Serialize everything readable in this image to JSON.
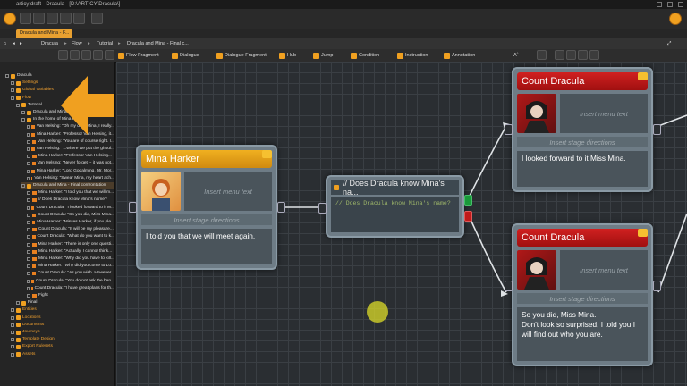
{
  "window": {
    "title": "articy:draft - Dracula - [D:\\ARTICY\\Dracula\\]"
  },
  "tab": {
    "label": "Dracula and Mina - F..."
  },
  "breadcrumb": [
    "Dracula",
    "Flow",
    "Tutorial",
    "Dracula and Mina - Final c..."
  ],
  "toolbar": {
    "items": [
      "Flow Fragment",
      "Dialogue",
      "Dialogue Fragment",
      "Hub",
      "Jump",
      "Condition",
      "Instruction",
      "Annotation"
    ],
    "font_size": "Aˆ"
  },
  "sidebar": {
    "tree": [
      {
        "label": "Dracula",
        "indent": 0,
        "orange": false
      },
      {
        "label": "Settings",
        "indent": 1,
        "orange": true
      },
      {
        "label": "Global Variables",
        "indent": 1,
        "orange": true
      },
      {
        "label": "Flow",
        "indent": 1,
        "orange": true
      },
      {
        "label": "Tutorial",
        "indent": 2,
        "orange": false
      },
      {
        "label": "Dracula and Mina - First meeting",
        "indent": 3,
        "orange": false
      },
      {
        "label": "In the home of Mina Harker",
        "indent": 3,
        "orange": false
      },
      {
        "label": "Van Helsing: \"Oh my dear Mina, I really...",
        "indent": 4,
        "orange": false
      },
      {
        "label": "Mina Harker: \"Professor Van Helsing, it...",
        "indent": 4,
        "orange": false
      },
      {
        "label": "Van Helsing: \"You are of course right. I...",
        "indent": 4,
        "orange": false
      },
      {
        "label": "Van Helsing: \"...where we put the ghoul...",
        "indent": 4,
        "orange": false
      },
      {
        "label": "Mina Harker: \"Professor Van Helsing...",
        "indent": 4,
        "orange": false
      },
      {
        "label": "Van Helsing: \"Never forget -- it was not...",
        "indent": 4,
        "orange": false
      },
      {
        "label": "Mina Harker: \"Lord Godalming, Mr. Mor...",
        "indent": 4,
        "orange": false
      },
      {
        "label": "Van Helsing: \"Swear Mina, my heart ach...",
        "indent": 4,
        "orange": false
      },
      {
        "label": "Dracula and Mina - Final confrontation",
        "indent": 3,
        "orange": false,
        "selected": true
      },
      {
        "label": "Mina Harker: \"I told you that we will m...",
        "indent": 4,
        "orange": false
      },
      {
        "label": "// Does Dracula know Mina's name?",
        "indent": 4,
        "orange": false
      },
      {
        "label": "Count Dracula: \"I looked forward to it M...",
        "indent": 4,
        "orange": false
      },
      {
        "label": "Count Dracula: \"So you did, Miss Mina...",
        "indent": 4,
        "orange": false
      },
      {
        "label": "Mina Harker: \"Misses Harker, if you ple...",
        "indent": 4,
        "orange": false
      },
      {
        "label": "Count Dracula: \"It will be my pleasure...",
        "indent": 4,
        "orange": false
      },
      {
        "label": "Count Dracula: \"What do you want to k...",
        "indent": 4,
        "orange": false
      },
      {
        "label": "Mina Harker: \"There is only one questi...",
        "indent": 4,
        "orange": false
      },
      {
        "label": "Mina Harker: \"Actually, I cannot think...",
        "indent": 4,
        "orange": false
      },
      {
        "label": "Mina Harker: \"Why did you have to kill...",
        "indent": 4,
        "orange": false
      },
      {
        "label": "Mina Harker: \"Why did you come to Lo...",
        "indent": 4,
        "orange": false
      },
      {
        "label": "Count Dracula: \"As you wish. However...",
        "indent": 4,
        "orange": false
      },
      {
        "label": "Count Dracula: \"You do not ask the ben...",
        "indent": 4,
        "orange": false
      },
      {
        "label": "Count Dracula: \"I have great plans for th...",
        "indent": 4,
        "orange": false
      },
      {
        "label": "Fight",
        "indent": 4,
        "orange": false
      },
      {
        "label": "Final",
        "indent": 2,
        "orange": false
      },
      {
        "label": "Entities",
        "indent": 1,
        "orange": true
      },
      {
        "label": "Locations",
        "indent": 1,
        "orange": true
      },
      {
        "label": "Documents",
        "indent": 1,
        "orange": true
      },
      {
        "label": "Journeys",
        "indent": 1,
        "orange": true
      },
      {
        "label": "Template Design",
        "indent": 1,
        "orange": true
      },
      {
        "label": "Export Rulesets",
        "indent": 1,
        "orange": true
      },
      {
        "label": "Assets",
        "indent": 1,
        "orange": true
      }
    ]
  },
  "nodes": {
    "mina": {
      "speaker": "Mina Harker",
      "menu_placeholder": "Insert menu text",
      "stage_placeholder": "Insert stage directions",
      "text": "I told you that we will meet again."
    },
    "condition": {
      "title": "// Does Dracula know Mina's na...",
      "body": "// Does Dracula know Mina's name?"
    },
    "dracula_top": {
      "speaker": "Count Dracula",
      "menu_placeholder": "Insert menu text",
      "stage_placeholder": "Insert stage directions",
      "text": "I looked forward to it Miss Mina."
    },
    "dracula_bottom": {
      "speaker": "Count Dracula",
      "menu_placeholder": "Insert menu text",
      "stage_placeholder": "Insert stage directions",
      "text": "So you did, Miss Mina.\nDon't look so surprised, I told you I will find out who you are."
    }
  },
  "colors": {
    "accent": "#f0a020",
    "speaker_mina": "#e8a010",
    "speaker_dracula": "#c01a1a"
  }
}
